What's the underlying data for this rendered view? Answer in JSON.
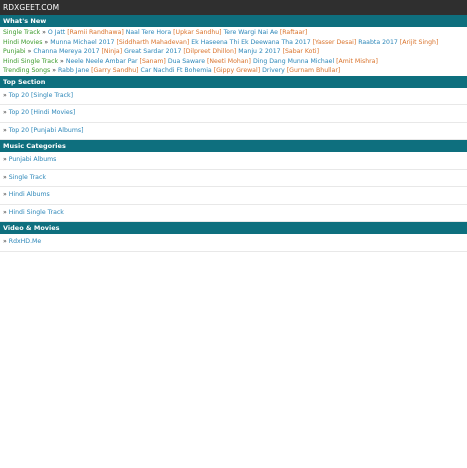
{
  "site": {
    "title": "RDXGEET.COM"
  },
  "whats_new": {
    "heading": "What's New",
    "rows": [
      {
        "category": "Single Track",
        "items": [
          {
            "t": "O Jatt",
            "k": "l"
          },
          {
            "t": "[Ramii Randhawa]",
            "k": "a"
          },
          {
            "t": "Naal Tere Hora",
            "k": "l"
          },
          {
            "t": "[Upkar Sandhu]",
            "k": "a"
          },
          {
            "t": "Tere Wargi Nai Ae",
            "k": "l"
          },
          {
            "t": "[Raftaar]",
            "k": "a"
          }
        ]
      },
      {
        "category": "Hindi Movies",
        "items": [
          {
            "t": "Munna Michael 2017",
            "k": "l"
          },
          {
            "t": "[Siddharth Mahadevan]",
            "k": "a"
          },
          {
            "t": "Ek Haseena Thi Ek Deewana Tha 2017",
            "k": "l"
          },
          {
            "t": "[Yasser Desai]",
            "k": "a"
          },
          {
            "t": "Raabta 2017",
            "k": "l"
          },
          {
            "t": "[Arijit Singh]",
            "k": "a"
          }
        ]
      },
      {
        "category": "Punjabi",
        "items": [
          {
            "t": "Channa Mereya 2017",
            "k": "l"
          },
          {
            "t": "[Ninja]",
            "k": "a"
          },
          {
            "t": "Great Sardar 2017",
            "k": "l"
          },
          {
            "t": "[Dilpreet Dhillon]",
            "k": "a"
          },
          {
            "t": "Manju 2 2017",
            "k": "l"
          },
          {
            "t": "[Sabar Koti]",
            "k": "a"
          }
        ]
      },
      {
        "category": "Hindi Single Track",
        "items": [
          {
            "t": "Neele Neele Ambar Par",
            "k": "l"
          },
          {
            "t": "[Sanam]",
            "k": "a"
          },
          {
            "t": "Dua Saware",
            "k": "l"
          },
          {
            "t": "[Neeti Mohan]",
            "k": "a"
          },
          {
            "t": "Ding Dang Munna Michael",
            "k": "l"
          },
          {
            "t": "[Amit Mishra]",
            "k": "a"
          }
        ]
      },
      {
        "category": "Trending Songs",
        "items": [
          {
            "t": "Rabb Jane",
            "k": "l"
          },
          {
            "t": "[Garry Sandhu]",
            "k": "a"
          },
          {
            "t": "Car Nachdi Ft Bohemia",
            "k": "l"
          },
          {
            "t": "[Gippy Grewal]",
            "k": "a"
          },
          {
            "t": "Drivery",
            "k": "l"
          },
          {
            "t": "[Gurnam Bhullar]",
            "k": "a"
          }
        ]
      }
    ]
  },
  "top_section": {
    "heading": "Top Section",
    "links": [
      "Top 20 [Single Track]",
      "Top 20 [Hindi Movies]",
      "Top 20 [Punjabi Albums]"
    ]
  },
  "music_categories": {
    "heading": "Music Categories",
    "links": [
      "Punjabi Albums",
      "Single Track",
      "Hindi Albums",
      "Hindi Single Track"
    ]
  },
  "video_movies": {
    "heading": "Video & Movies",
    "links": [
      "RdxHD.Me"
    ]
  },
  "colors": {
    "header_bg": "#2f2f2f",
    "section_bg": "#0e6f7e",
    "category": "#3a9a2a",
    "link": "#2b86b8",
    "artist": "#d9722a"
  }
}
